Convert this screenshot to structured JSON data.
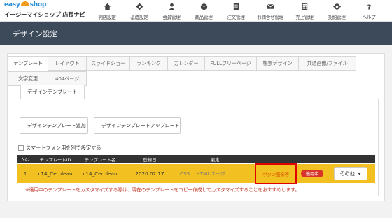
{
  "header": {
    "logo_brand_a": "easy",
    "logo_brand_b": "shop",
    "logo_sub": "イージーマイショップ 店長ナビ",
    "nav": [
      {
        "label": "開店設定",
        "icon": "home-icon"
      },
      {
        "label": "基礎設定",
        "icon": "gear-icon"
      },
      {
        "label": "会員管理",
        "icon": "user-icon"
      },
      {
        "label": "商品管理",
        "icon": "box-icon"
      },
      {
        "label": "注文管理",
        "icon": "document-icon"
      },
      {
        "label": "お問合せ管理",
        "icon": "mail-icon"
      },
      {
        "label": "売上管理",
        "icon": "calculator-icon"
      },
      {
        "label": "契約管理",
        "icon": "settings-icon"
      },
      {
        "label": "ヘルプ",
        "icon": "question-icon"
      }
    ]
  },
  "page_title": "デザイン設定",
  "tabs_row1": [
    "テンプレート",
    "レイアウト",
    "スライドショー",
    "ランキング",
    "カレンダー",
    "FULLフリーページ",
    "帳票デザイン",
    "共通画像/ファイル"
  ],
  "tabs_row2": [
    "文字変更",
    "404ページ"
  ],
  "subtab": "デザインテンプレート",
  "buttons": {
    "add_template": "デザインテンプレート追加",
    "upload_template": "デザインテンプレートアップロード"
  },
  "checkbox_label": "スマートフォン用を別で設定する",
  "table": {
    "headers": {
      "no": "No.",
      "id": "テンプレートID",
      "name": "テンプレート名",
      "date": "登録日",
      "edit": "編集"
    },
    "row": {
      "no": "1",
      "id": "c14_Cerulean",
      "name": "c14_Cerulean",
      "date": "2020.02.17",
      "css": "CSS",
      "html": "HTMLページ",
      "button_image": "ボタン画像等",
      "badge": "適用中",
      "other": "その他"
    }
  },
  "note": "※適用中のテンプレートをカスタマイズする際は、現在のテンプレートをコピー作成してカスタマイズすることをおすすめします。",
  "colors": {
    "topbar": "#ffffff",
    "titlebar": "#3d4a5a",
    "row_highlight": "#f3c022",
    "badge": "#d9342b",
    "highlight_box": "#e00000"
  }
}
